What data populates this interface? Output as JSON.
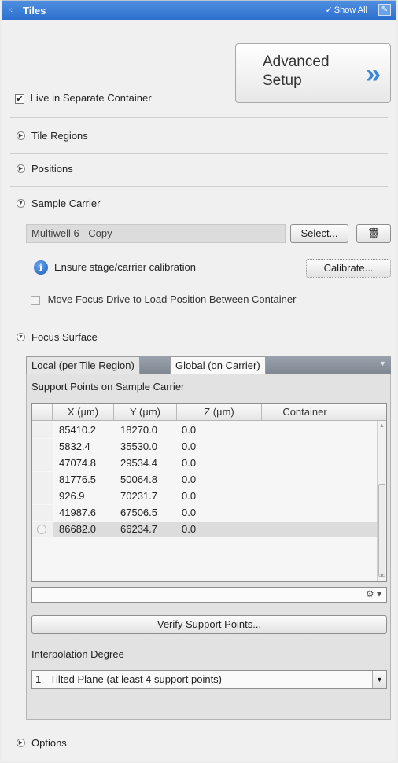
{
  "titlebar": {
    "title": "Tiles",
    "show_all": "Show All"
  },
  "advanced": {
    "line1": "Advanced",
    "line2": "Setup",
    "chevron": "»"
  },
  "live_container": {
    "label": "Live in Separate Container",
    "checked": "✔"
  },
  "sections": {
    "tile_regions": "Tile Regions",
    "positions": "Positions",
    "sample_carrier": "Sample Carrier",
    "focus_surface": "Focus Surface",
    "options": "Options"
  },
  "carrier": {
    "value": "Multiwell 6 - Copy",
    "select_label": "Select...",
    "delete_icon": "trash-icon",
    "ensure_text": "Ensure stage/carrier calibration",
    "calibrate_label": "Calibrate...",
    "move_focus_label": "Move Focus Drive to Load Position Between Container"
  },
  "focus": {
    "tabs": [
      "Local (per Tile Region)",
      "Global (on Carrier)"
    ],
    "support_label": "Support Points on Sample Carrier",
    "columns": [
      "X (µm)",
      "Y (µm)",
      "Z (µm)",
      "Container"
    ],
    "rows": [
      [
        "85410.2",
        "18270.0",
        "0.0",
        ""
      ],
      [
        "5832.4",
        "35530.0",
        "0.0",
        ""
      ],
      [
        "47074.8",
        "29534.4",
        "0.0",
        ""
      ],
      [
        "81776.5",
        "50064.8",
        "0.0",
        ""
      ],
      [
        "926.9",
        "70231.7",
        "0.0",
        ""
      ],
      [
        "41987.6",
        "67506.5",
        "0.0",
        ""
      ],
      [
        "86682.0",
        "66234.7",
        "0.0",
        ""
      ]
    ],
    "verify_label": "Verify Support Points...",
    "interp_label": "Interpolation Degree",
    "interp_value": "1 - Tilted Plane (at least 4 support points)"
  }
}
